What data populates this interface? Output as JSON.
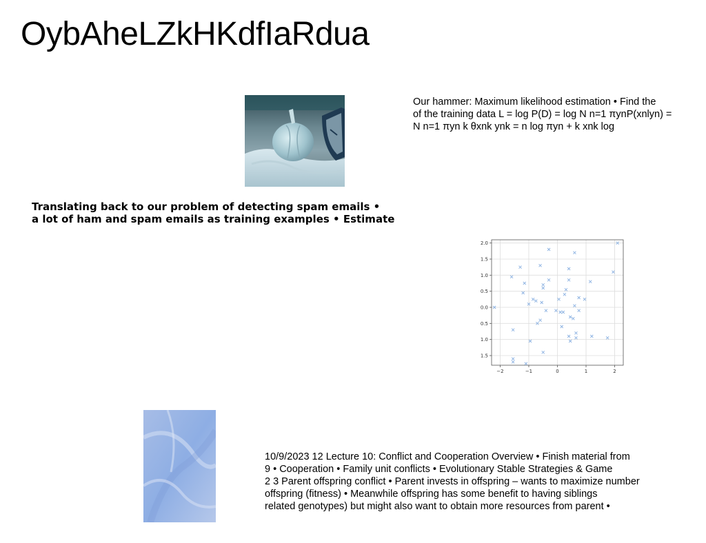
{
  "title": "OybAheLZkHKdfIaRdua",
  "hammer_lines": [
    "Our hammer: Maximum likelihood estimation • Find the",
    "of the training data L = log P(D) = log N  n=1 πynP(xnlyn) =",
    "N  n=1  πyn  k θxnk ynk  =  n  log πyn +  k xnk log"
  ],
  "spam_lines": [
    "Translating back to our problem of detecting spam emails •",
    "a lot of ham and spam emails as training examples • Estimate"
  ],
  "lecture_lines": [
    "10/9/2023 12 Lecture 10: Conflict and Cooperation Overview • Finish material from",
    "9 • Cooperation • Family unit conflicts • Evolutionary Stable Strategies & Game",
    "2 3 Parent offspring conflict • Parent invests in offspring – wants to maximize number",
    "offspring (fitness) • Meanwhile offspring has some benefit to having siblings",
    "related genotypes) but might also want to obtain more resources from parent •"
  ],
  "colors": {
    "marker": "#8fb4e3",
    "grid": "#dddddd",
    "axis": "#555555"
  },
  "chart_data": {
    "type": "scatter",
    "marker": "x",
    "grid": true,
    "xlim": [
      -2.3,
      2.3
    ],
    "ylim": [
      -1.8,
      2.1
    ],
    "xticks": [
      -2,
      -1,
      0,
      1,
      2
    ],
    "yticks": [
      -1.5,
      -1.0,
      -0.5,
      0.0,
      0.5,
      1.0,
      1.5,
      2.0
    ],
    "xtick_labels": [
      "−2",
      "−1",
      "0",
      "1",
      "2"
    ],
    "ytick_labels": [
      "−1.5",
      "−1.0",
      "−0.5",
      "0.0",
      "0.5",
      "1.0",
      "1.5",
      "2.0"
    ],
    "points": [
      [
        -2.2,
        0.0
      ],
      [
        -1.6,
        0.95
      ],
      [
        -1.3,
        1.25
      ],
      [
        -1.55,
        -0.7
      ],
      [
        -1.55,
        -1.6
      ],
      [
        -1.55,
        -1.7
      ],
      [
        -1.2,
        0.45
      ],
      [
        -1.15,
        0.75
      ],
      [
        -1.1,
        -1.75
      ],
      [
        -1.0,
        0.1
      ],
      [
        -0.95,
        -1.05
      ],
      [
        -0.85,
        0.25
      ],
      [
        -0.75,
        0.2
      ],
      [
        -0.7,
        -0.5
      ],
      [
        -0.6,
        1.3
      ],
      [
        -0.6,
        -0.4
      ],
      [
        -0.55,
        0.15
      ],
      [
        -0.5,
        0.6
      ],
      [
        -0.5,
        0.7
      ],
      [
        -0.5,
        -1.4
      ],
      [
        -0.4,
        -0.1
      ],
      [
        -0.3,
        0.85
      ],
      [
        -0.3,
        1.8
      ],
      [
        -0.05,
        -0.1
      ],
      [
        0.05,
        0.25
      ],
      [
        0.1,
        -0.15
      ],
      [
        0.2,
        -0.15
      ],
      [
        0.15,
        -0.6
      ],
      [
        0.25,
        0.4
      ],
      [
        0.3,
        0.55
      ],
      [
        0.4,
        0.85
      ],
      [
        0.4,
        1.2
      ],
      [
        0.4,
        -0.9
      ],
      [
        0.45,
        -1.05
      ],
      [
        0.45,
        -0.3
      ],
      [
        0.55,
        -0.35
      ],
      [
        0.6,
        1.7
      ],
      [
        0.6,
        0.05
      ],
      [
        0.65,
        -0.8
      ],
      [
        0.65,
        -0.95
      ],
      [
        0.75,
        0.3
      ],
      [
        0.75,
        -0.1
      ],
      [
        0.95,
        0.25
      ],
      [
        1.15,
        0.8
      ],
      [
        1.2,
        -0.9
      ],
      [
        1.75,
        -0.95
      ],
      [
        1.95,
        1.1
      ],
      [
        2.1,
        2.0
      ]
    ]
  }
}
